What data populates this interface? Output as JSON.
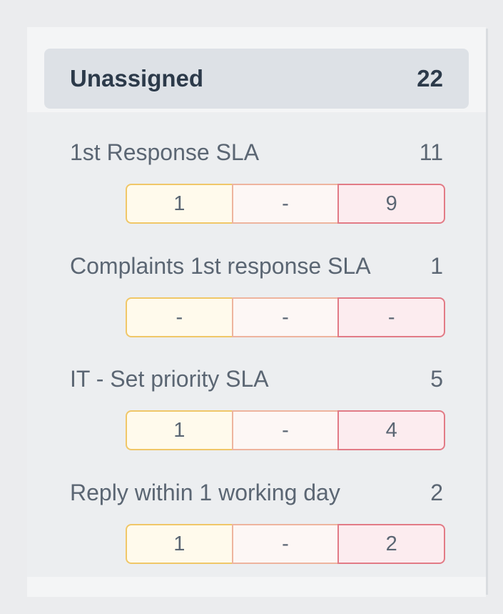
{
  "header": {
    "label": "Unassigned",
    "count": "22"
  },
  "slas": [
    {
      "name": "1st Response SLA",
      "count": "11",
      "segments": [
        "1",
        "-",
        "9"
      ]
    },
    {
      "name": "Complaints 1st response SLA",
      "count": "1",
      "segments": [
        "-",
        "-",
        "-"
      ]
    },
    {
      "name": "IT - Set priority SLA",
      "count": "5",
      "segments": [
        "1",
        "-",
        "4"
      ]
    },
    {
      "name": "Reply within 1 working day",
      "count": "2",
      "segments": [
        "1",
        "-",
        "2"
      ]
    }
  ],
  "colors": {
    "segment_warning": "#f0c768",
    "segment_neutral": "#eeb49e",
    "segment_breached": "#e27b86"
  }
}
